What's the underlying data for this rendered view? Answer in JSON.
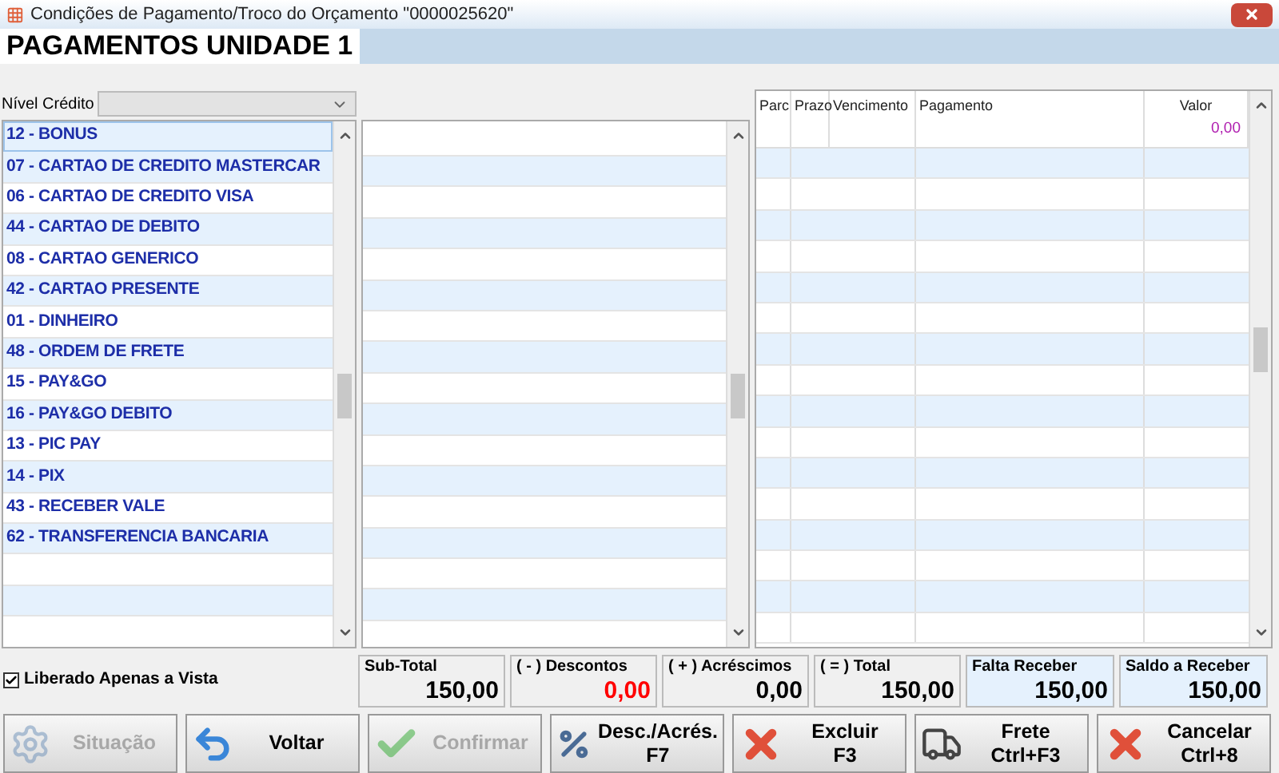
{
  "window": {
    "title": "Condições de Pagamento/Troco do Orçamento \"0000025620\""
  },
  "tab": {
    "label": "PAGAMENTOS UNIDADE 1",
    "selected": true
  },
  "nivel_credito": {
    "label": "Nível Crédito"
  },
  "payment_methods": [
    {
      "label": "12 - BONUS",
      "selected": true
    },
    {
      "label": "07 - CARTAO DE CREDITO MASTERCAR",
      "selected": false
    },
    {
      "label": "06 - CARTAO DE CREDITO VISA",
      "selected": false
    },
    {
      "label": "44 - CARTAO DE DEBITO",
      "selected": false
    },
    {
      "label": "08 - CARTAO GENERICO",
      "selected": false
    },
    {
      "label": "42 - CARTAO PRESENTE",
      "selected": false
    },
    {
      "label": "01 - DINHEIRO",
      "selected": false
    },
    {
      "label": "48 - ORDEM DE FRETE",
      "selected": false
    },
    {
      "label": "15 - PAY&GO",
      "selected": false
    },
    {
      "label": "16 - PAY&GO DEBITO",
      "selected": false
    },
    {
      "label": "13 - PIC PAY",
      "selected": false
    },
    {
      "label": "14 - PIX",
      "selected": false
    },
    {
      "label": "43 - RECEBER VALE",
      "selected": false
    },
    {
      "label": "62 - TRANSFERENCIA BANCARIA",
      "selected": false
    }
  ],
  "installments_table": {
    "columns": [
      "Parc",
      "Prazo",
      "Vencimento",
      "Pagamento",
      "Valor"
    ],
    "rows": [
      {
        "valor": "0,00"
      }
    ]
  },
  "liberado_apenas_a_vista": {
    "label": "Liberado Apenas a Vista",
    "checked": true
  },
  "totals": [
    {
      "label": "Sub-Total",
      "value": "150,00",
      "color": "#000000",
      "highlighted": false
    },
    {
      "label": "( - ) Descontos",
      "value": "0,00",
      "color": "#ff0000",
      "highlighted": false
    },
    {
      "label": "( + ) Acréscimos",
      "value": "0,00",
      "color": "#000000",
      "highlighted": false
    },
    {
      "label": "( = ) Total",
      "value": "150,00",
      "color": "#000000",
      "highlighted": false
    },
    {
      "label": "Falta Receber",
      "value": "150,00",
      "color": "#000000",
      "highlighted": true
    },
    {
      "label": "Saldo a Receber",
      "value": "150,00",
      "color": "#000000",
      "highlighted": true
    }
  ],
  "buttons": [
    {
      "kind": "gear",
      "label": "Situação",
      "disabled": true
    },
    {
      "kind": "undo",
      "label": "Voltar",
      "disabled": false
    },
    {
      "kind": "check",
      "label": "Confirmar",
      "disabled": true
    },
    {
      "kind": "percent",
      "label": "Desc./Acrés.",
      "shortcut": "F7",
      "disabled": false
    },
    {
      "kind": "delete",
      "label": "Excluir",
      "shortcut": "F3",
      "disabled": false
    },
    {
      "kind": "truck",
      "label": "Frete",
      "shortcut": "Ctrl+F3",
      "disabled": false
    },
    {
      "kind": "delete",
      "label": "Cancelar",
      "shortcut": "Ctrl+8",
      "disabled": false
    }
  ]
}
